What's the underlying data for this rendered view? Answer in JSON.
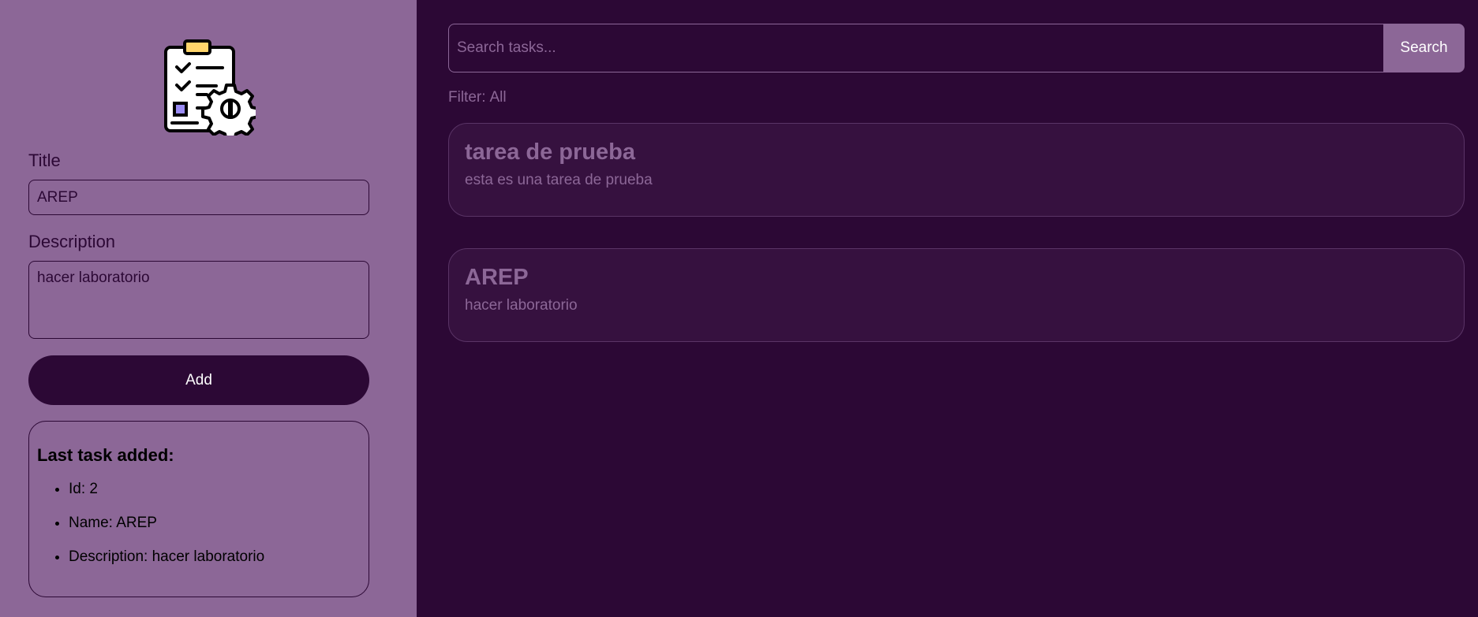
{
  "form": {
    "logo_icon": "clipboard-gear-icon",
    "title_label": "Title",
    "title_value": "AREP",
    "description_label": "Description",
    "description_value": "hacer laboratorio",
    "add_label": "Add"
  },
  "last_task": {
    "heading": "Last task added:",
    "items": [
      "Id: 2",
      "Name: AREP",
      "Description: hacer laboratorio"
    ]
  },
  "search": {
    "placeholder": "Search tasks...",
    "value": "",
    "button_label": "Search"
  },
  "filter": {
    "label": "Filter:",
    "value": "All"
  },
  "tasks": [
    {
      "title": "tarea de prueba",
      "description": "esta es una tarea de prueba"
    },
    {
      "title": "AREP",
      "description": "hacer laboratorio"
    }
  ],
  "colors": {
    "background": "#2c0835",
    "sidebar": "#8c6797",
    "card": "#36113f",
    "accent": "#8c6797",
    "logo_clip": "#ffd56b",
    "logo_check": "#9b8cf5"
  }
}
